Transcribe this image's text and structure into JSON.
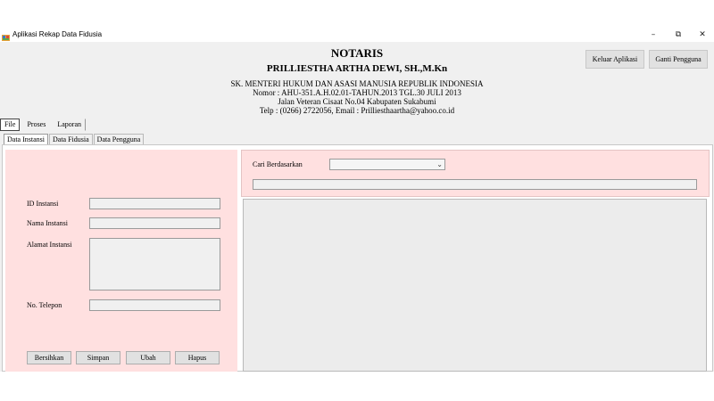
{
  "window": {
    "title": "Aplikasi Rekap Data Fidusia",
    "controls": {
      "minimize": "–",
      "restore": "⧉",
      "close": "✕"
    }
  },
  "header": {
    "title": "NOTARIS",
    "name": "PRILLIESTHA ARTHA DEWI, SH.,M.Kn",
    "line1": "SK. MENTERI HUKUM DAN ASASI MANUSIA REPUBLIK INDONESIA",
    "line2": "Nomor : AHU-351.A.H.02.01-TAHUN.2013 TGL.30 JULI 2013",
    "line3": "Jalan Veteran Cisaat No.04 Kabupaten Sukabumi",
    "line4": "Telp : (0266) 2722056, Email : Prilliesthaartha@yahoo.co.id"
  },
  "top_buttons": {
    "exit": "Keluar Aplikasi",
    "switch_user": "Ganti Pengguna"
  },
  "menu": [
    "File",
    "Proses",
    "Laporan"
  ],
  "tabs": [
    "Data Instansi",
    "Data Fidusia",
    "Data Pengguna"
  ],
  "form": {
    "id_label": "ID Instansi",
    "name_label": "Nama Instansi",
    "address_label": "Alamat Instansi",
    "phone_label": "No. Telepon",
    "id_value": "",
    "name_value": "",
    "address_value": "",
    "phone_value": ""
  },
  "actions": {
    "clear": "Bersihkan",
    "save": "Simpan",
    "edit": "Ubah",
    "delete": "Hapus"
  },
  "search": {
    "label": "Cari Berdasarkan",
    "selected": "",
    "query": ""
  },
  "colors": {
    "panel_pink": "#ffe0e0",
    "window_bg": "#f0f0f0"
  }
}
